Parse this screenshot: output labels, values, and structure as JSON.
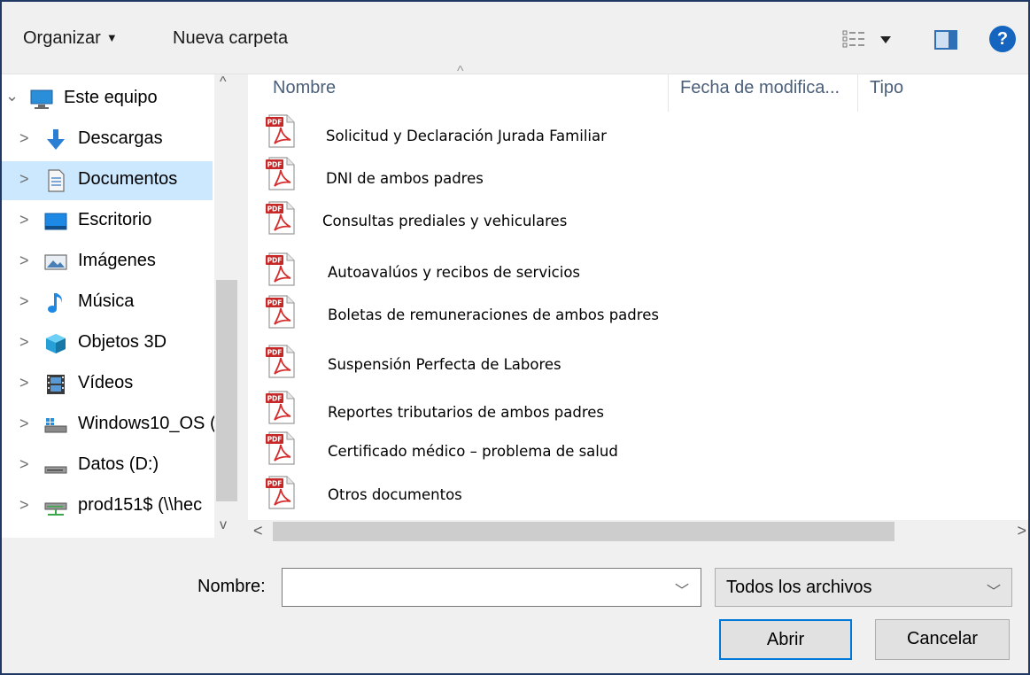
{
  "toolbar": {
    "organize_label": "Organizar",
    "new_folder_label": "Nueva carpeta",
    "help_label": "?"
  },
  "nav": {
    "items": [
      {
        "label": "Este equipo",
        "icon": "computer-icon",
        "expanded": true
      },
      {
        "label": "Descargas",
        "icon": "download-icon"
      },
      {
        "label": "Documentos",
        "icon": "documents-icon",
        "selected": true
      },
      {
        "label": "Escritorio",
        "icon": "desktop-icon"
      },
      {
        "label": "Imágenes",
        "icon": "pictures-icon"
      },
      {
        "label": "Música",
        "icon": "music-icon"
      },
      {
        "label": "Objetos 3D",
        "icon": "objects3d-icon"
      },
      {
        "label": "Vídeos",
        "icon": "videos-icon"
      },
      {
        "label": "Windows10_OS (",
        "icon": "drive-icon"
      },
      {
        "label": "Datos (D:)",
        "icon": "drive-icon"
      },
      {
        "label": "prod151$ (\\\\hec",
        "icon": "network-drive-icon"
      }
    ]
  },
  "columns": {
    "name": "Nombre",
    "date": "Fecha de modifica...",
    "type": "Tipo"
  },
  "files": [
    {
      "name": "Solicitud y Declaración Jurada Familiar",
      "icon": "pdf-icon"
    },
    {
      "name": "DNI de ambos padres",
      "icon": "pdf-icon"
    },
    {
      "name": "Consultas prediales y vehiculares",
      "icon": "pdf-icon"
    },
    {
      "name": "Autoavalúos y recibos de servicios",
      "icon": "pdf-icon"
    },
    {
      "name": "Boletas de remuneraciones de ambos padres",
      "icon": "pdf-icon"
    },
    {
      "name": "Suspensión Perfecta de Labores",
      "icon": "pdf-icon"
    },
    {
      "name": "Reportes tributarios de ambos padres",
      "icon": "pdf-icon"
    },
    {
      "name": "Certificado médico – problema de salud",
      "icon": "pdf-icon"
    },
    {
      "name": "Otros documentos",
      "icon": "pdf-icon"
    }
  ],
  "bottom": {
    "name_label": "Nombre:",
    "name_value": "",
    "filter_label": "Todos los archivos",
    "open_label": "Abrir",
    "cancel_label": "Cancelar"
  },
  "colors": {
    "selected_bg": "#cce8ff",
    "accent": "#0078d7",
    "pdf_red": "#d32f2f"
  }
}
